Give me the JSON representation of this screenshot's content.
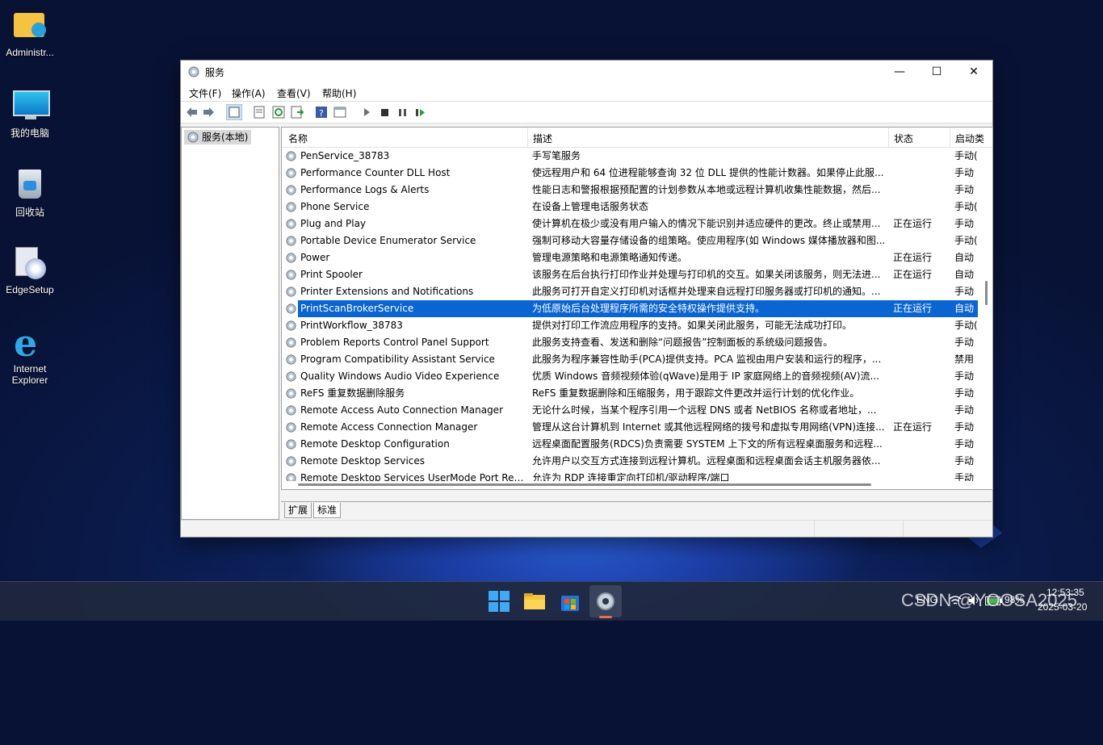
{
  "desktop": {
    "icons": [
      {
        "label": "Administr..."
      },
      {
        "label": "我的电脑"
      },
      {
        "label": "回收站"
      },
      {
        "label": "EdgeSetup"
      },
      {
        "label": "Internet Explorer"
      }
    ]
  },
  "window": {
    "title": "服务",
    "controls": {
      "minimize": "—",
      "maximize": "☐",
      "close": "✕"
    },
    "menu": [
      "文件(F)",
      "操作(A)",
      "查看(V)",
      "帮助(H)"
    ],
    "left_pane_item": "服务(本地)",
    "columns": [
      "名称",
      "描述",
      "状态",
      "启动类"
    ],
    "rows": [
      {
        "name": "PenService_38783",
        "desc": "手写笔服务",
        "status": "",
        "start": "手动("
      },
      {
        "name": "Performance Counter DLL Host",
        "desc": "使远程用户和 64 位进程能够查询 32 位 DLL 提供的性能计数器。如果停止此服...",
        "status": "",
        "start": "手动"
      },
      {
        "name": "Performance Logs & Alerts",
        "desc": "性能日志和警报根据预配置的计划参数从本地或远程计算机收集性能数据，然后...",
        "status": "",
        "start": "手动"
      },
      {
        "name": "Phone Service",
        "desc": "在设备上管理电话服务状态",
        "status": "",
        "start": "手动("
      },
      {
        "name": "Plug and Play",
        "desc": "使计算机在极少或没有用户输入的情况下能识别并适应硬件的更改。终止或禁用...",
        "status": "正在运行",
        "start": "手动"
      },
      {
        "name": "Portable Device Enumerator Service",
        "desc": "强制可移动大容量存储设备的组策略。使应用程序(如 Windows 媒体播放器和图...",
        "status": "",
        "start": "手动("
      },
      {
        "name": "Power",
        "desc": "管理电源策略和电源策略通知传递。",
        "status": "正在运行",
        "start": "自动"
      },
      {
        "name": "Print Spooler",
        "desc": "该服务在后台执行打印作业并处理与打印机的交互。如果关闭该服务，则无法进...",
        "status": "正在运行",
        "start": "自动"
      },
      {
        "name": "Printer Extensions and Notifications",
        "desc": "此服务可打开自定义打印机对话框并处理来自远程打印服务器或打印机的通知。...",
        "status": "",
        "start": "手动"
      },
      {
        "name": "PrintScanBrokerService",
        "desc": "为低原始后台处理程序所需的安全特权操作提供支持。",
        "status": "正在运行",
        "start": "自动",
        "selected": true
      },
      {
        "name": "PrintWorkflow_38783",
        "desc": "提供对打印工作流应用程序的支持。如果关闭此服务，可能无法成功打印。",
        "status": "",
        "start": "手动("
      },
      {
        "name": "Problem Reports Control Panel Support",
        "desc": "此服务支持查看、发送和删除“问题报告”控制面板的系统级问题报告。",
        "status": "",
        "start": "手动"
      },
      {
        "name": "Program Compatibility Assistant Service",
        "desc": "此服务为程序兼容性助手(PCA)提供支持。PCA 监视由用户安装和运行的程序，...",
        "status": "",
        "start": "禁用"
      },
      {
        "name": "Quality Windows Audio Video Experience",
        "desc": "优质 Windows 音频视频体验(qWave)是用于 IP 家庭网络上的音频视频(AV)流...",
        "status": "",
        "start": "手动"
      },
      {
        "name": "ReFS 重复数据删除服务",
        "desc": "ReFS 重复数据删除和压缩服务，用于跟踪文件更改并运行计划的优化作业。",
        "status": "",
        "start": "手动"
      },
      {
        "name": "Remote Access Auto Connection Manager",
        "desc": "无论什么时候，当某个程序引用一个远程 DNS 或者 NetBIOS 名称或者地址，...",
        "status": "",
        "start": "手动"
      },
      {
        "name": "Remote Access Connection Manager",
        "desc": "管理从这台计算机到 Internet 或其他远程网络的拨号和虚拟专用网络(VPN)连接...",
        "status": "正在运行",
        "start": "手动"
      },
      {
        "name": "Remote Desktop Configuration",
        "desc": "远程桌面配置服务(RDCS)负责需要 SYSTEM 上下文的所有远程桌面服务和远程...",
        "status": "",
        "start": "手动"
      },
      {
        "name": "Remote Desktop Services",
        "desc": "允许用户以交互方式连接到远程计算机。远程桌面和远程桌面会话主机服务器依...",
        "status": "",
        "start": "手动"
      },
      {
        "name": "Remote Desktop Services UserMode Port Red...",
        "desc": "允许为 RDP 连接重定向打印机/驱动程序/端口",
        "status": "",
        "start": "手动"
      }
    ],
    "tabs": [
      "扩展",
      "标准"
    ]
  },
  "taskbar": {
    "tray": {
      "lang": "ENG",
      "time": "12:53:35",
      "date": "2025-03-20",
      "battery": "98%",
      "watermark": "CSDN @YOOSA2025"
    }
  },
  "colors": {
    "selection": "#0a64d2",
    "accent": "#0078d4"
  }
}
